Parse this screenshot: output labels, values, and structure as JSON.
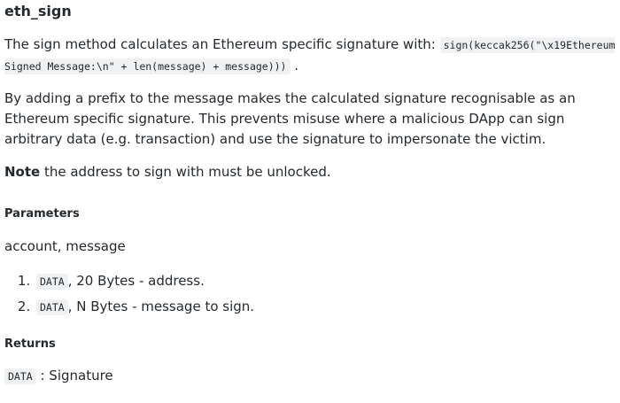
{
  "title": "eth_sign",
  "intro": {
    "text": "The sign method calculates an Ethereum specific signature with:",
    "code": "sign(keccak256(\"\\x19Ethereum Signed Message:\\n\" + len(message) + message)))",
    "end": "."
  },
  "paragraph2": "By adding a prefix to the message makes the calculated signature recognisable as an Ethereum specific signature. This prevents misuse where a malicious DApp can sign arbitrary data (e.g. transaction) and use the signature to impersonate the victim.",
  "note": {
    "bold": "Note",
    "text": " the address to sign with must be unlocked."
  },
  "parameters": {
    "heading": "Parameters",
    "text": "account, message",
    "items": [
      {
        "code": "DATA",
        "text": ", 20 Bytes - address."
      },
      {
        "code": "DATA",
        "text": ", N Bytes - message to sign."
      }
    ]
  },
  "returns": {
    "heading": "Returns",
    "code": "DATA",
    "text": " : Signature"
  }
}
